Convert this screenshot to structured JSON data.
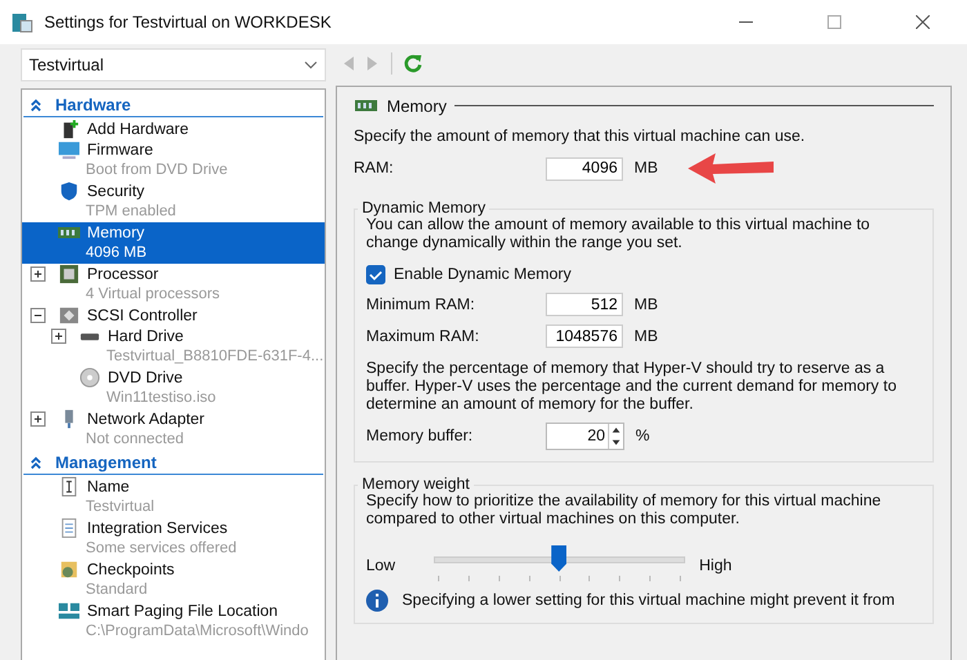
{
  "window": {
    "title": "Settings for Testvirtual on WORKDESK"
  },
  "vm_selector": {
    "value": "Testvirtual"
  },
  "toolbar": {
    "back_disabled": true,
    "forward_disabled": true
  },
  "sidebar": {
    "sections": [
      {
        "title": "Hardware",
        "expanded": true,
        "items": [
          {
            "label": "Add Hardware",
            "selected": false
          },
          {
            "label": "Firmware",
            "detail": "Boot from DVD Drive",
            "selected": false
          },
          {
            "label": "Security",
            "detail": "TPM enabled",
            "selected": false
          },
          {
            "label": "Memory",
            "detail": "4096 MB",
            "selected": true
          },
          {
            "label": "Processor",
            "detail": "4 Virtual processors",
            "selected": false,
            "expanded": false
          },
          {
            "label": "SCSI Controller",
            "selected": false,
            "expanded": true,
            "children": [
              {
                "label": "Hard Drive",
                "detail": "Testvirtual_B8810FDE-631F-4...",
                "selected": false,
                "expanded": false
              },
              {
                "label": "DVD Drive",
                "detail": "Win11testiso.iso",
                "selected": false
              }
            ]
          },
          {
            "label": "Network Adapter",
            "detail": "Not connected",
            "selected": false,
            "expanded": false
          }
        ]
      },
      {
        "title": "Management",
        "expanded": true,
        "items": [
          {
            "label": "Name",
            "detail": "Testvirtual",
            "selected": false
          },
          {
            "label": "Integration Services",
            "detail": "Some services offered",
            "selected": false
          },
          {
            "label": "Checkpoints",
            "detail": "Standard",
            "selected": false
          },
          {
            "label": "Smart Paging File Location",
            "detail": "C:\\ProgramData\\Microsoft\\Windo",
            "selected": false
          }
        ]
      }
    ]
  },
  "panel": {
    "title": "Memory",
    "intro": "Specify the amount of memory that this virtual machine can use.",
    "ram": {
      "label": "RAM:",
      "value": "4096",
      "unit": "MB"
    },
    "dynamic_memory": {
      "title": "Dynamic Memory",
      "description": "You can allow the amount of memory available to this virtual machine to change dynamically within the range you set.",
      "enable": {
        "label": "Enable Dynamic Memory",
        "checked": true
      },
      "minimum": {
        "label": "Minimum RAM:",
        "value": "512",
        "unit": "MB"
      },
      "maximum": {
        "label": "Maximum RAM:",
        "value": "1048576",
        "unit": "MB"
      },
      "buffer_description": "Specify the percentage of memory that Hyper-V should try to reserve as a buffer. Hyper-V uses the percentage and the current demand for memory to determine an amount of memory for the buffer.",
      "buffer": {
        "label": "Memory buffer:",
        "value": "20",
        "unit": "%"
      }
    },
    "memory_weight": {
      "title": "Memory weight",
      "description": "Specify how to prioritize the availability of memory for this virtual machine compared to other virtual machines on this computer.",
      "low_label": "Low",
      "high_label": "High",
      "level": 0.5,
      "info": "Specifying a lower setting for this virtual machine might prevent it from"
    }
  }
}
